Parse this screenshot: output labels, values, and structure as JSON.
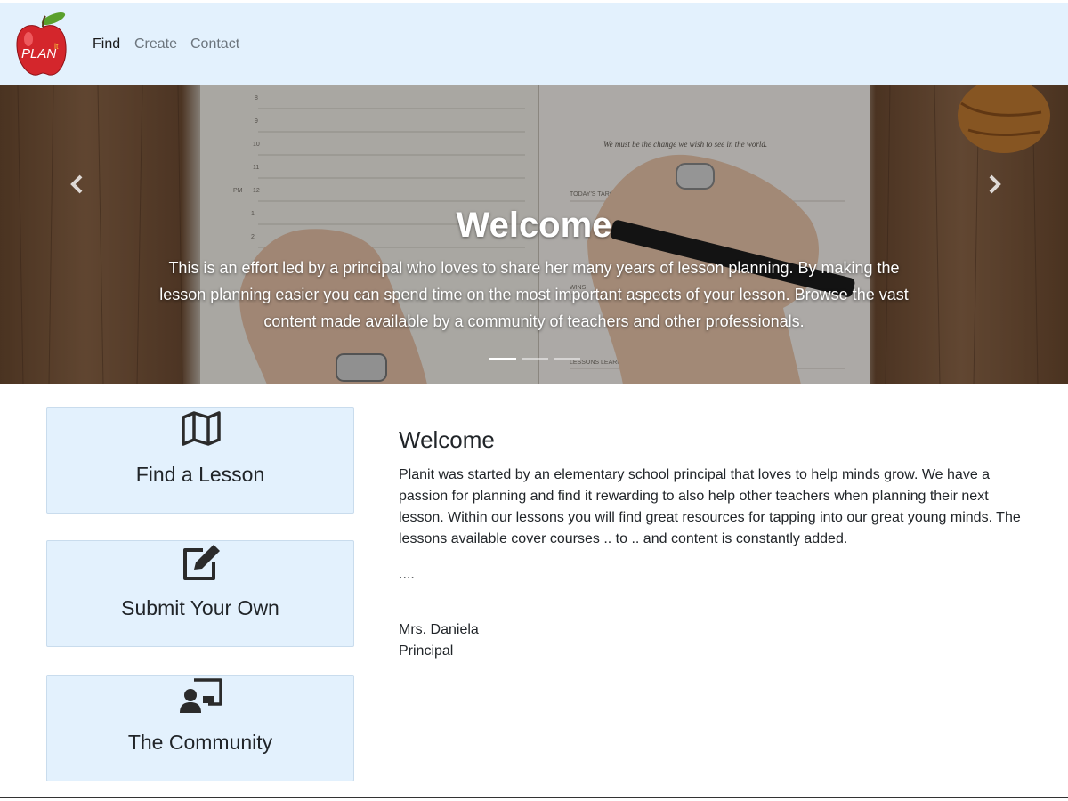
{
  "brand": {
    "logo_text": "PLAN",
    "logo_superscript": "it",
    "apple_color": "#d4262c",
    "leaf_color": "#5aa02c"
  },
  "nav": {
    "items": [
      {
        "label": "Find"
      },
      {
        "label": "Create"
      },
      {
        "label": "Contact"
      }
    ]
  },
  "hero": {
    "title": "Welcome",
    "text": "This is an effort led by a principal who loves to share her many years of lesson planning. By making the lesson planning easier you can spend time on the most important aspects of your lesson. Browse the vast content made available by a community of teachers and other professionals.",
    "slide_count": 3,
    "active_slide": 1,
    "notebook_quote": "We must be the change we wish to see in the world.",
    "notebook_labels": {
      "targets": "TODAY'S TARGETS",
      "wins": "WINS",
      "lessons": "LESSONS LEARNED:",
      "pm": "PM"
    },
    "notebook_hours": [
      "8",
      "9",
      "10",
      "11",
      "12",
      "1",
      "2"
    ]
  },
  "cards": [
    {
      "label": "Find a Lesson",
      "icon": "map-icon"
    },
    {
      "label": "Submit Your Own",
      "icon": "edit-icon"
    },
    {
      "label": "The Community",
      "icon": "chalkboard-teacher-icon"
    }
  ],
  "main": {
    "heading": "Welcome",
    "paragraph": "Planit was started by an elementary school principal that loves to help minds grow. We have a passion for planning and find it rewarding to also help other teachers when planning their next lesson. Within our lessons you will find great resources for tapping into our great young minds. The lessons available cover courses .. to .. and content is constantly added.",
    "ellipsis": "....",
    "signature_name": "Mrs. Daniela",
    "signature_title": "Principal"
  },
  "colors": {
    "nav_bg": "#e3f1fd",
    "card_bg": "#e3f1fd",
    "text": "#212529",
    "muted": "#6c757d"
  }
}
